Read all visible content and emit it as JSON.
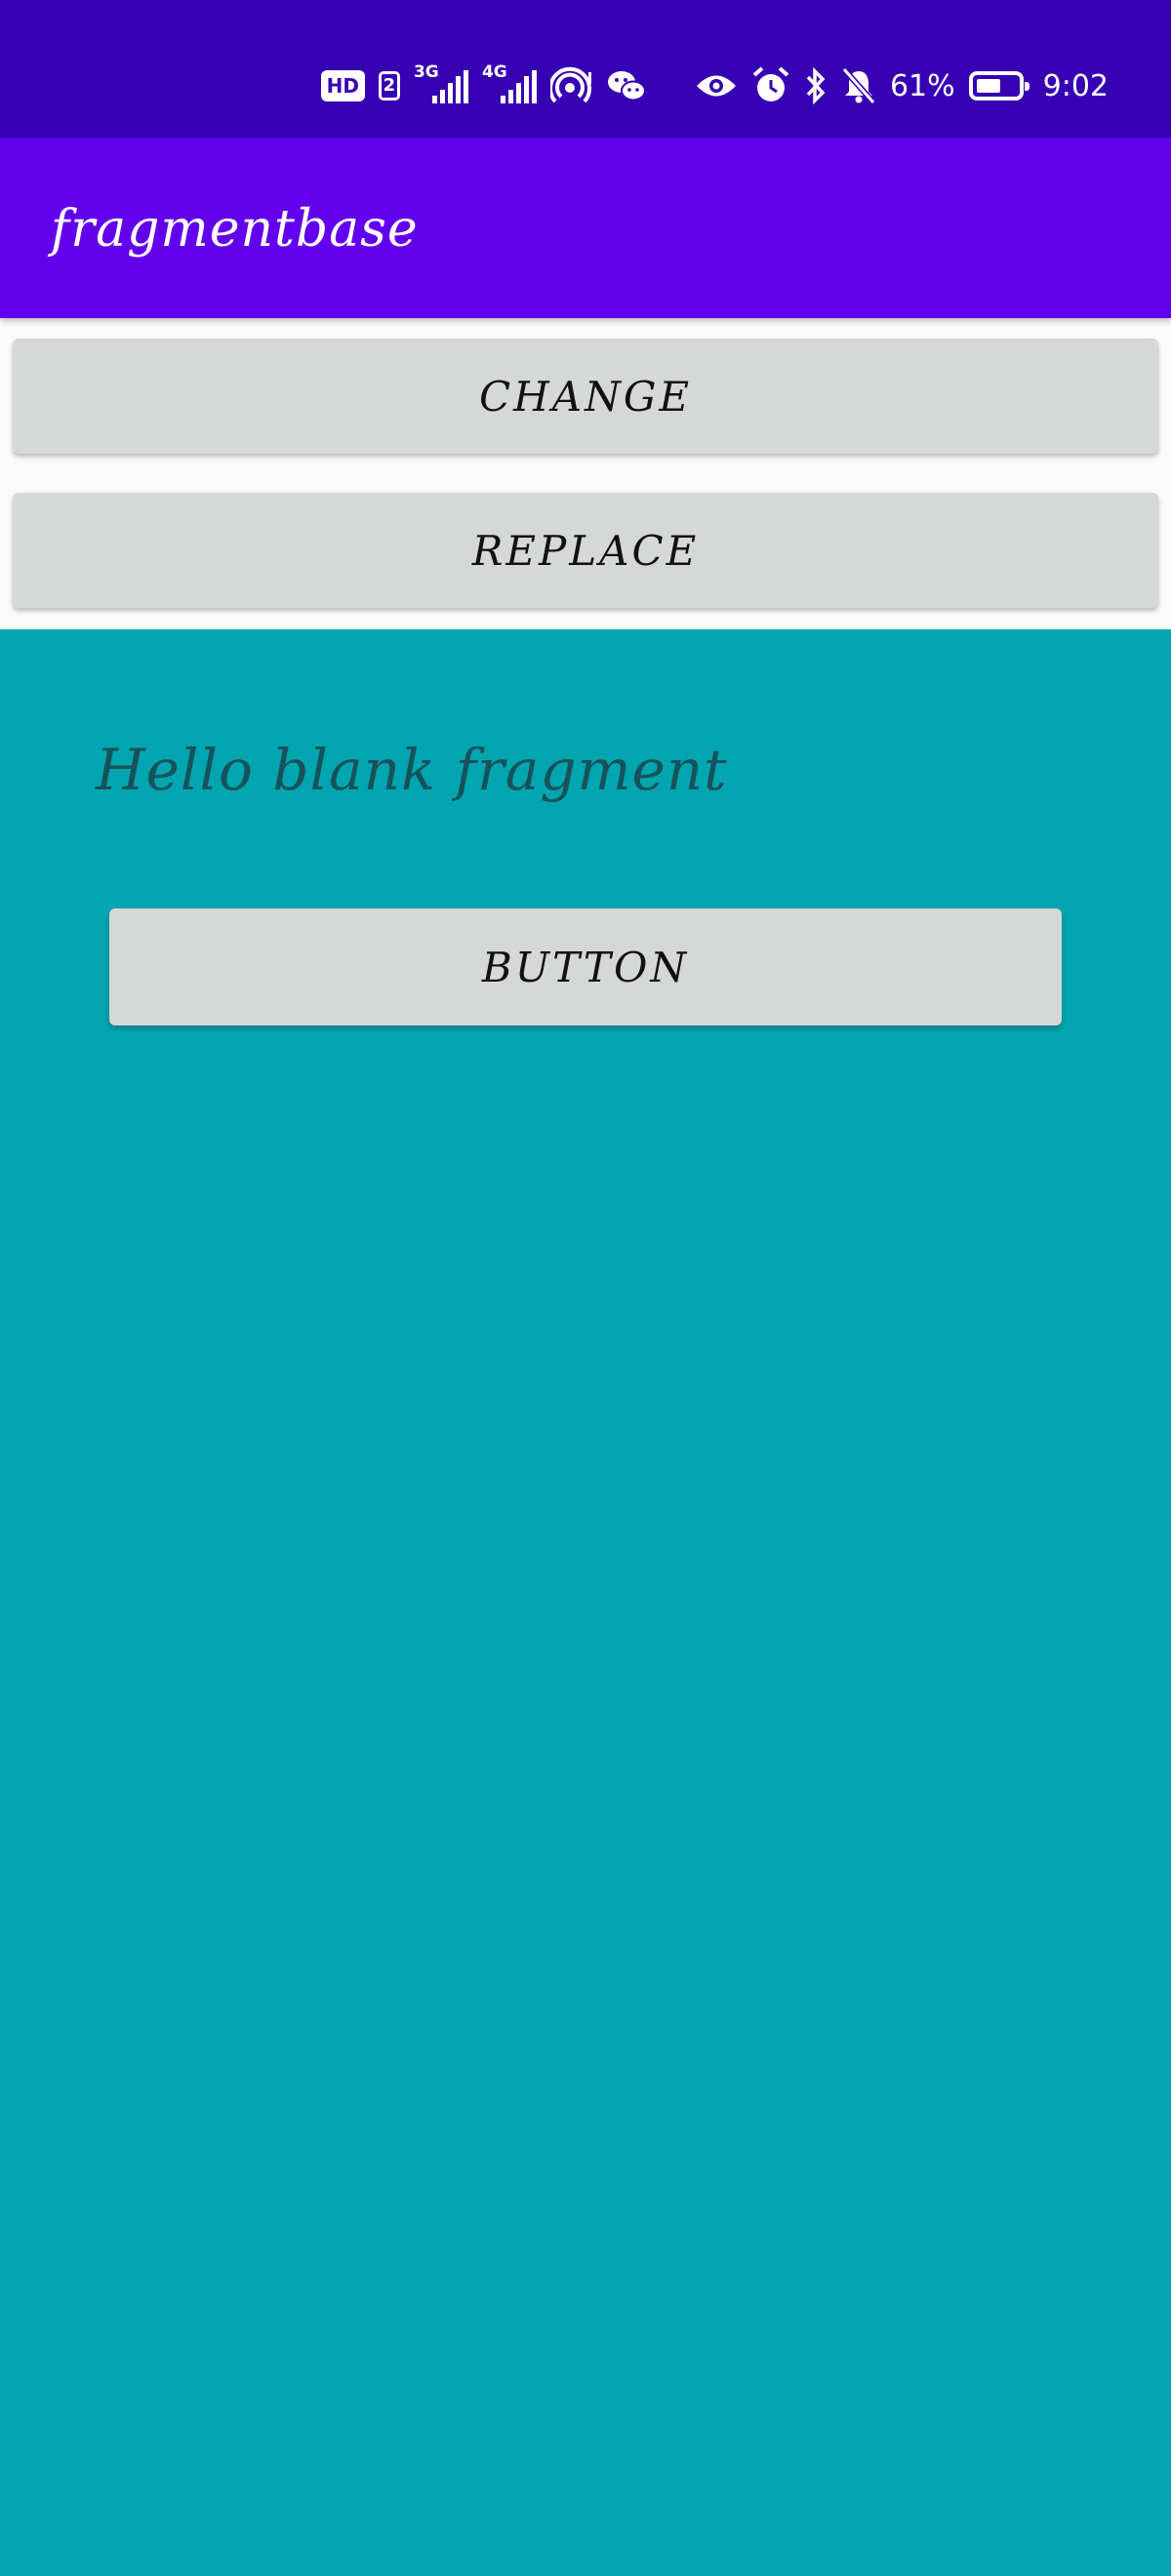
{
  "status_bar": {
    "icons": [
      "hd-icon",
      "sim-2-icon",
      "signal-3g-icon",
      "signal-4g-icon",
      "hotspot-icon",
      "wechat-icon",
      "eye-comfort-icon",
      "alarm-icon",
      "bluetooth-icon",
      "mute-icon",
      "battery-icon"
    ],
    "hd": "HD",
    "sim": "2",
    "net1": "3G",
    "net2": "4G",
    "battery_pct": "61%",
    "battery_level": 0.61,
    "time": "9:02"
  },
  "app_bar": {
    "title": "fragmentbase"
  },
  "buttons": {
    "change": "CHANGE",
    "replace": "REPLACE"
  },
  "fragment": {
    "text": "Hello blank fragment",
    "button": "BUTTON"
  },
  "colors": {
    "status_bar": "#3700b3",
    "app_bar": "#6200ee",
    "fragment_bg": "#00a5b0",
    "button_bg": "#d6d7d7",
    "fragment_text": "#17525a"
  }
}
